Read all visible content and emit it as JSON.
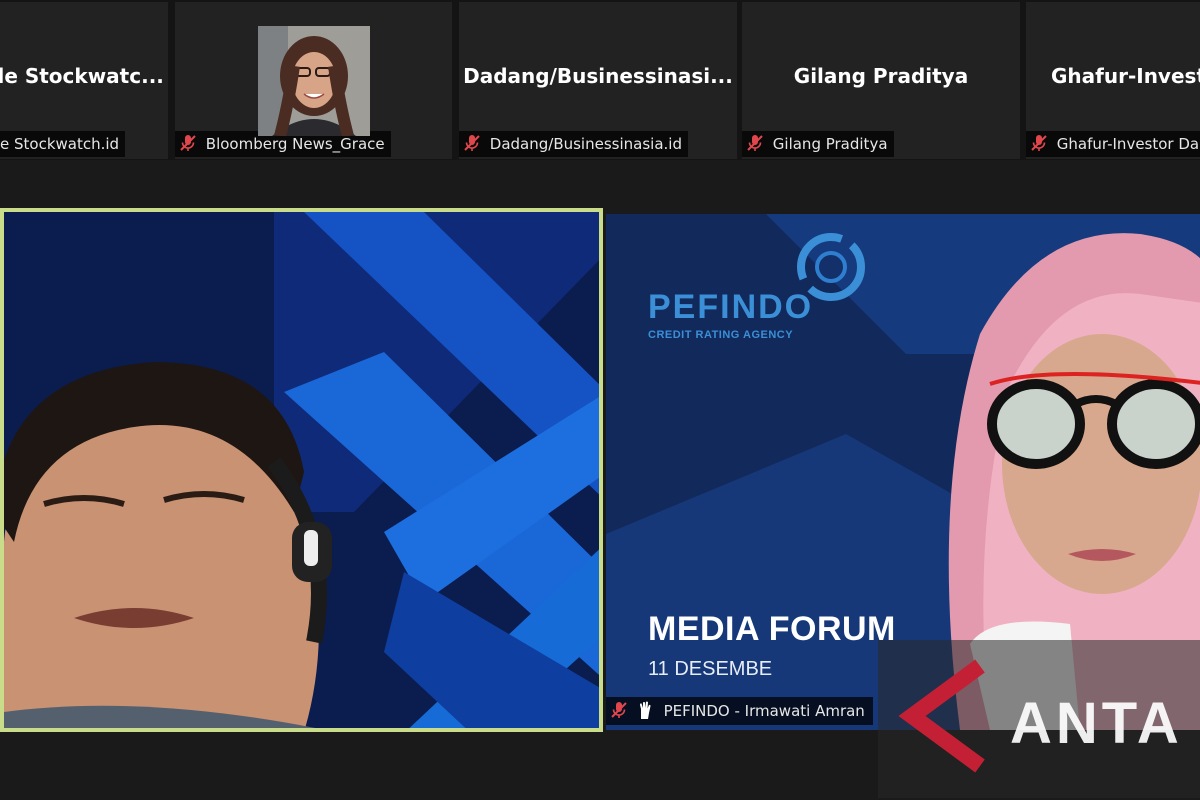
{
  "top_strip": {
    "tiles": [
      {
        "display_name": "de Stockwatc...",
        "label": "e Stockwatch.id"
      },
      {
        "display_name": "",
        "label": "Bloomberg News_Grace"
      },
      {
        "display_name": "Dadang/Businessinasi...",
        "label": "Dadang/Businessinasia.id"
      },
      {
        "display_name": "Gilang Praditya",
        "label": "Gilang Praditya"
      },
      {
        "display_name": "Ghafur-Invest",
        "label": "Ghafur-Investor Dai"
      }
    ]
  },
  "presentation": {
    "brand_name": "PEFINDO",
    "brand_sub": "CREDIT RATING AGENCY",
    "event_title": "MEDIA FORUM",
    "event_date": "11 DESEMBE"
  },
  "speaker": {
    "label": "PEFINDO - Irmawati Amran"
  },
  "watermark": {
    "text": "ANTA"
  },
  "colors": {
    "active_speaker_border": "#c9dc8a",
    "mic_muted": "#e0474c",
    "brand_blue": "#3b8fd6"
  }
}
